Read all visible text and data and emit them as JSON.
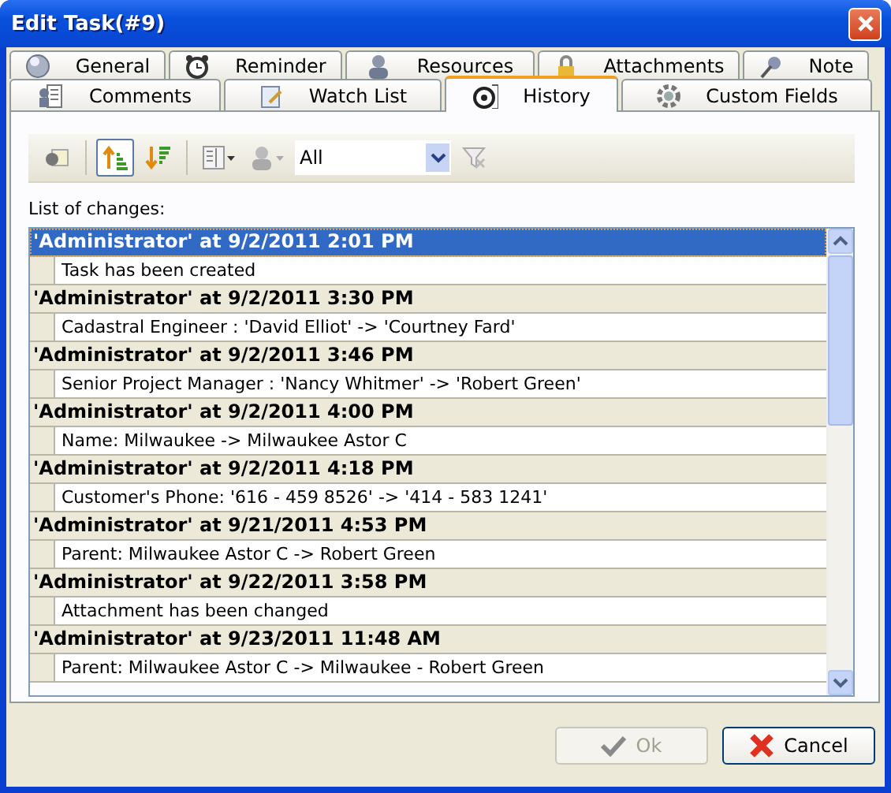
{
  "window": {
    "title": "Edit Task(#9)"
  },
  "tab_rows": [
    [
      {
        "label": "General",
        "selected": false
      },
      {
        "label": "Reminder",
        "selected": false
      },
      {
        "label": "Resources",
        "selected": false
      },
      {
        "label": "Attachments",
        "selected": false
      },
      {
        "label": "Note",
        "selected": false
      }
    ],
    [
      {
        "label": "Comments",
        "selected": false
      },
      {
        "label": "Watch List",
        "selected": false
      },
      {
        "label": "History",
        "selected": true
      },
      {
        "label": "Custom Fields",
        "selected": false
      }
    ]
  ],
  "toolbar": {
    "sort_ascending": {
      "pressed": true
    },
    "sort_descending": {
      "pressed": false
    },
    "filter": {
      "value": "All"
    }
  },
  "list_label": "List of changes:",
  "changes": [
    {
      "header": "'Administrator' at 9/2/2011 2:01 PM",
      "detail": "Task has been created",
      "selected": true
    },
    {
      "header": "'Administrator' at 9/2/2011 3:30 PM",
      "detail": "Cadastral Engineer : 'David Elliot' -> 'Courtney Fard'",
      "selected": false
    },
    {
      "header": "'Administrator' at 9/2/2011 3:46 PM",
      "detail": "Senior Project Manager : 'Nancy Whitmer' -> 'Robert Green'",
      "selected": false
    },
    {
      "header": "'Administrator' at 9/2/2011 4:00 PM",
      "detail": "Name: Milwaukee -> Milwaukee Astor C",
      "selected": false
    },
    {
      "header": "'Administrator' at 9/2/2011 4:18 PM",
      "detail": "Customer's Phone: '616 - 459 8526' -> '414 - 583 1241'",
      "selected": false
    },
    {
      "header": "'Administrator' at 9/21/2011 4:53 PM",
      "detail": "Parent: Milwaukee Astor C -> Robert Green",
      "selected": false
    },
    {
      "header": "'Administrator' at 9/22/2011 3:58 PM",
      "detail": "Attachment has been changed",
      "selected": false
    },
    {
      "header": "'Administrator' at 9/23/2011 11:48 AM",
      "detail": "Parent: Milwaukee Astor C -> Milwaukee - Robert Green",
      "selected": false
    }
  ],
  "buttons": [
    {
      "label": "Ok",
      "kind": "ok",
      "disabled": true
    },
    {
      "label": "Cancel",
      "kind": "cancel",
      "disabled": false
    }
  ]
}
